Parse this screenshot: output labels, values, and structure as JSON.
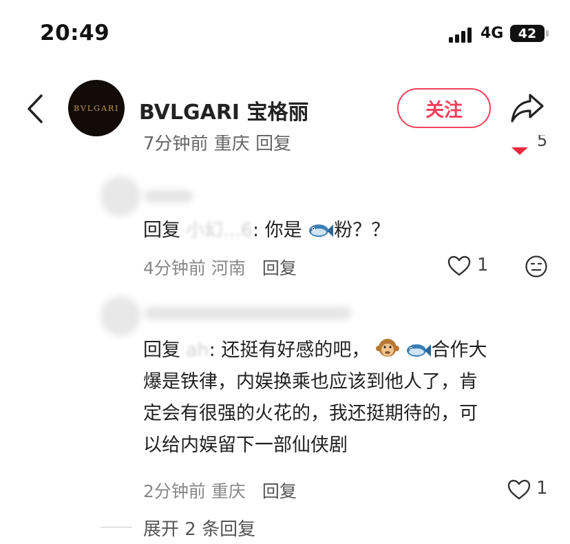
{
  "status_bar": {
    "time": "20:49",
    "network": "4G",
    "battery": "42"
  },
  "header": {
    "avatar_logo": "BVLGARI",
    "account_name": "BVLGARI 宝格丽",
    "follow_label": "关注"
  },
  "cut_row": {
    "meta": "7分钟前 重庆 回复",
    "likes": "5"
  },
  "comments": [
    {
      "reply_label": "回复",
      "masked_target": "小幻...6",
      "text_before_emoji": ": 你是",
      "text_after_emoji": "粉？？",
      "emoji": "fish-emoji",
      "time": "4分钟前",
      "location": "河南",
      "reply_button": "回复",
      "likes": "1"
    },
    {
      "reply_label": "回复",
      "masked_target": "ah",
      "line1_before": ": 还挺有好感的吧，",
      "line1_after": "合作大",
      "emojis": [
        "monkey-emoji",
        "fish-emoji"
      ],
      "line2": "爆是铁律，内娱换乘也应该到他人了，肯",
      "line3": "定会有很强的火花的，我还挺期待的，可",
      "line4": "以给内娱留下一部仙侠剧",
      "time": "2分钟前",
      "location": "重庆",
      "reply_button": "回复",
      "likes": "1"
    }
  ],
  "expand_replies": "展开 2 条回复",
  "colors": {
    "accent": "#f2405c",
    "heart_active": "#e8293f"
  }
}
